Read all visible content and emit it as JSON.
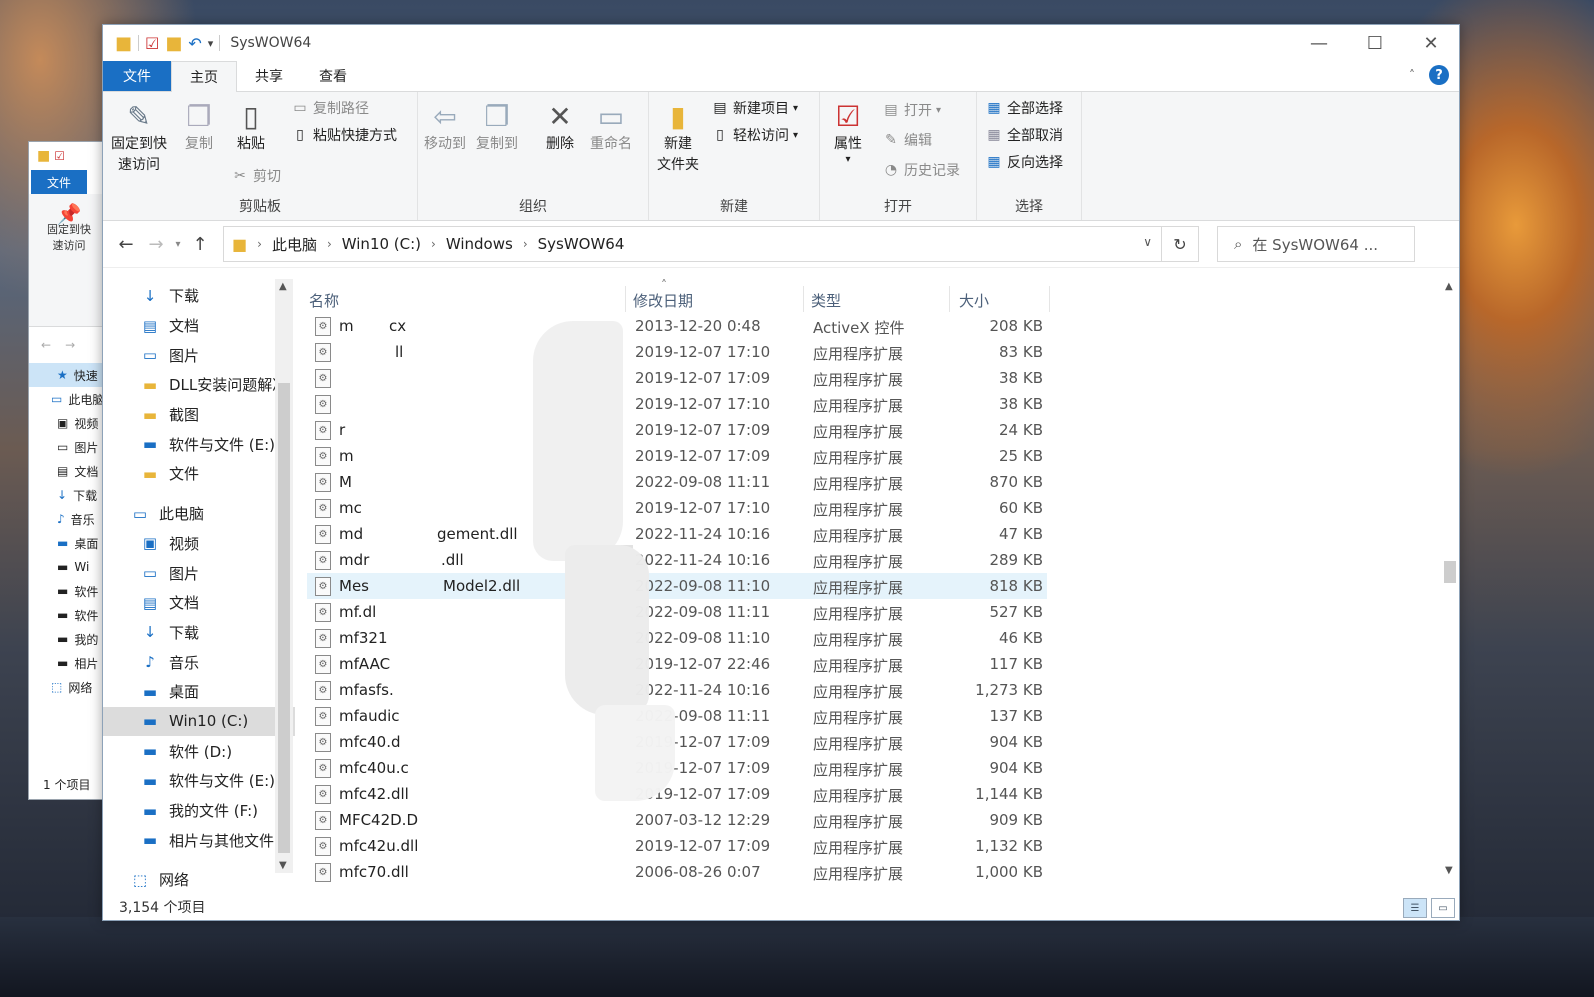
{
  "window": {
    "title": "SysWOW64",
    "controls": {
      "minimize": "—",
      "maximize": "☐",
      "close": "✕"
    }
  },
  "tabs": [
    {
      "label": "文件"
    },
    {
      "label": "主页"
    },
    {
      "label": "共享"
    },
    {
      "label": "查看"
    }
  ],
  "ribbon": {
    "clipboard": {
      "pin_label_1": "固定到快",
      "pin_label_2": "速访问",
      "copy": "复制",
      "paste": "粘贴",
      "copy_path": "复制路径",
      "paste_shortcut": "粘贴快捷方式",
      "cut": "剪切",
      "group": "剪贴板"
    },
    "organize": {
      "move_to": "移动到",
      "copy_to": "复制到",
      "delete": "删除",
      "rename": "重命名",
      "group": "组织"
    },
    "new": {
      "new_folder_1": "新建",
      "new_folder_2": "文件夹",
      "new_item": "新建项目",
      "easy_access": "轻松访问",
      "group": "新建"
    },
    "open": {
      "properties": "属性",
      "open": "打开",
      "edit": "编辑",
      "history": "历史记录",
      "group": "打开"
    },
    "select": {
      "select_all": "全部选择",
      "select_none": "全部取消",
      "invert": "反向选择",
      "group": "选择"
    }
  },
  "address": {
    "crumbs": [
      "此电脑",
      "Win10 (C:)",
      "Windows",
      "SysWOW64"
    ],
    "search_placeholder": "在 SysWOW64 ..."
  },
  "sidebar": {
    "items": [
      {
        "label": "下载",
        "icon": "↓",
        "pinned": true
      },
      {
        "label": "文档",
        "icon": "▤",
        "pinned": true
      },
      {
        "label": "图片",
        "icon": "▭",
        "pinned": true
      },
      {
        "label": "DLL安装问题解决",
        "icon": "▬",
        "pinned": false
      },
      {
        "label": "截图",
        "icon": "▬",
        "pinned": false
      },
      {
        "label": "软件与文件 (E:)",
        "icon": "▬",
        "pinned": false
      },
      {
        "label": "文件",
        "icon": "▬",
        "pinned": false
      },
      {
        "label": "此电脑",
        "icon": "▭",
        "pinned": false,
        "level": 0
      },
      {
        "label": "视频",
        "icon": "▣",
        "pinned": false
      },
      {
        "label": "图片",
        "icon": "▭",
        "pinned": false
      },
      {
        "label": "文档",
        "icon": "▤",
        "pinned": false
      },
      {
        "label": "下载",
        "icon": "↓",
        "pinned": false
      },
      {
        "label": "音乐",
        "icon": "♪",
        "pinned": false
      },
      {
        "label": "桌面",
        "icon": "▬",
        "pinned": false
      },
      {
        "label": "Win10 (C:)",
        "icon": "▬",
        "pinned": false,
        "selected": true
      },
      {
        "label": "软件 (D:)",
        "icon": "▬",
        "pinned": false
      },
      {
        "label": "软件与文件 (E:)",
        "icon": "▬",
        "pinned": false
      },
      {
        "label": "我的文件 (F:)",
        "icon": "▬",
        "pinned": false
      },
      {
        "label": "相片与其他文件",
        "icon": "▬",
        "pinned": false
      },
      {
        "label": "网络",
        "icon": "⬚",
        "pinned": false,
        "level": 0
      }
    ]
  },
  "columns": {
    "name": "名称",
    "date": "修改日期",
    "type": "类型",
    "size": "大小"
  },
  "files": [
    {
      "name": "m",
      "date": "2013-12-20 0:48",
      "type": "ActiveX 控件",
      "size": "208 KB"
    },
    {
      "name": "",
      "date": "2019-12-07 17:10",
      "type": "应用程序扩展",
      "size": "83 KB"
    },
    {
      "name": "",
      "date": "2019-12-07 17:09",
      "type": "应用程序扩展",
      "size": "38 KB"
    },
    {
      "name": "",
      "date": "2019-12-07 17:10",
      "type": "应用程序扩展",
      "size": "38 KB"
    },
    {
      "name": "r",
      "date": "2019-12-07 17:09",
      "type": "应用程序扩展",
      "size": "24 KB"
    },
    {
      "name": "m",
      "date": "2019-12-07 17:09",
      "type": "应用程序扩展",
      "size": "25 KB"
    },
    {
      "name": "M",
      "date": "2022-09-08 11:11",
      "type": "应用程序扩展",
      "size": "870 KB"
    },
    {
      "name": "mc",
      "date": "2019-12-07 17:10",
      "type": "应用程序扩展",
      "size": "60 KB"
    },
    {
      "name": "md",
      "date": "2022-11-24 10:16",
      "type": "应用程序扩展",
      "size": "47 KB"
    },
    {
      "name": "mdr",
      "date": "2022-11-24 10:16",
      "type": "应用程序扩展",
      "size": "289 KB"
    },
    {
      "name": "Mes",
      "date": "2022-09-08 11:10",
      "type": "应用程序扩展",
      "size": "818 KB",
      "selected": true
    },
    {
      "name": "mf.dl",
      "date": "2022-09-08 11:11",
      "type": "应用程序扩展",
      "size": "527 KB"
    },
    {
      "name": "mf321",
      "date": "2022-09-08 11:10",
      "type": "应用程序扩展",
      "size": "46 KB"
    },
    {
      "name": "mfAAC",
      "date": "2019-12-07 22:46",
      "type": "应用程序扩展",
      "size": "117 KB"
    },
    {
      "name": "mfasfs.",
      "date": "2022-11-24 10:16",
      "type": "应用程序扩展",
      "size": "1,273 KB"
    },
    {
      "name": "mfaudic",
      "date": "2022-09-08 11:11",
      "type": "应用程序扩展",
      "size": "137 KB"
    },
    {
      "name": "mfc40.d",
      "date": "2019-12-07 17:09",
      "type": "应用程序扩展",
      "size": "904 KB"
    },
    {
      "name": "mfc40u.c",
      "date": "2019-12-07 17:09",
      "type": "应用程序扩展",
      "size": "904 KB"
    },
    {
      "name": "mfc42.dll",
      "date": "2019-12-07 17:09",
      "type": "应用程序扩展",
      "size": "1,144 KB"
    },
    {
      "name": "MFC42D.D",
      "date": "2007-03-12 12:29",
      "type": "应用程序扩展",
      "size": "909 KB"
    },
    {
      "name": "mfc42u.dll",
      "date": "2019-12-07 17:09",
      "type": "应用程序扩展",
      "size": "1,132 KB"
    },
    {
      "name": "mfc70.dll",
      "date": "2006-08-26 0:07",
      "type": "应用程序扩展",
      "size": "1,000 KB"
    }
  ],
  "partial_names": {
    "row0_tail": "cx",
    "row1_tail": "ll",
    "row8_tail": "gement.dll",
    "row9_tail": ".dll",
    "row10_tail": "Model2.dll"
  },
  "status": {
    "count": "3,154 个项目"
  },
  "back_window": {
    "file_tab": "文件",
    "pin_1": "固定到快",
    "pin_2": "速访问",
    "items": [
      "快速",
      "此电脑",
      "视频",
      "图片",
      "文档",
      "下载",
      "音乐",
      "桌面",
      "Wi",
      "软件",
      "软件",
      "我的",
      "相片",
      "网络"
    ],
    "status": "1 个项目"
  }
}
